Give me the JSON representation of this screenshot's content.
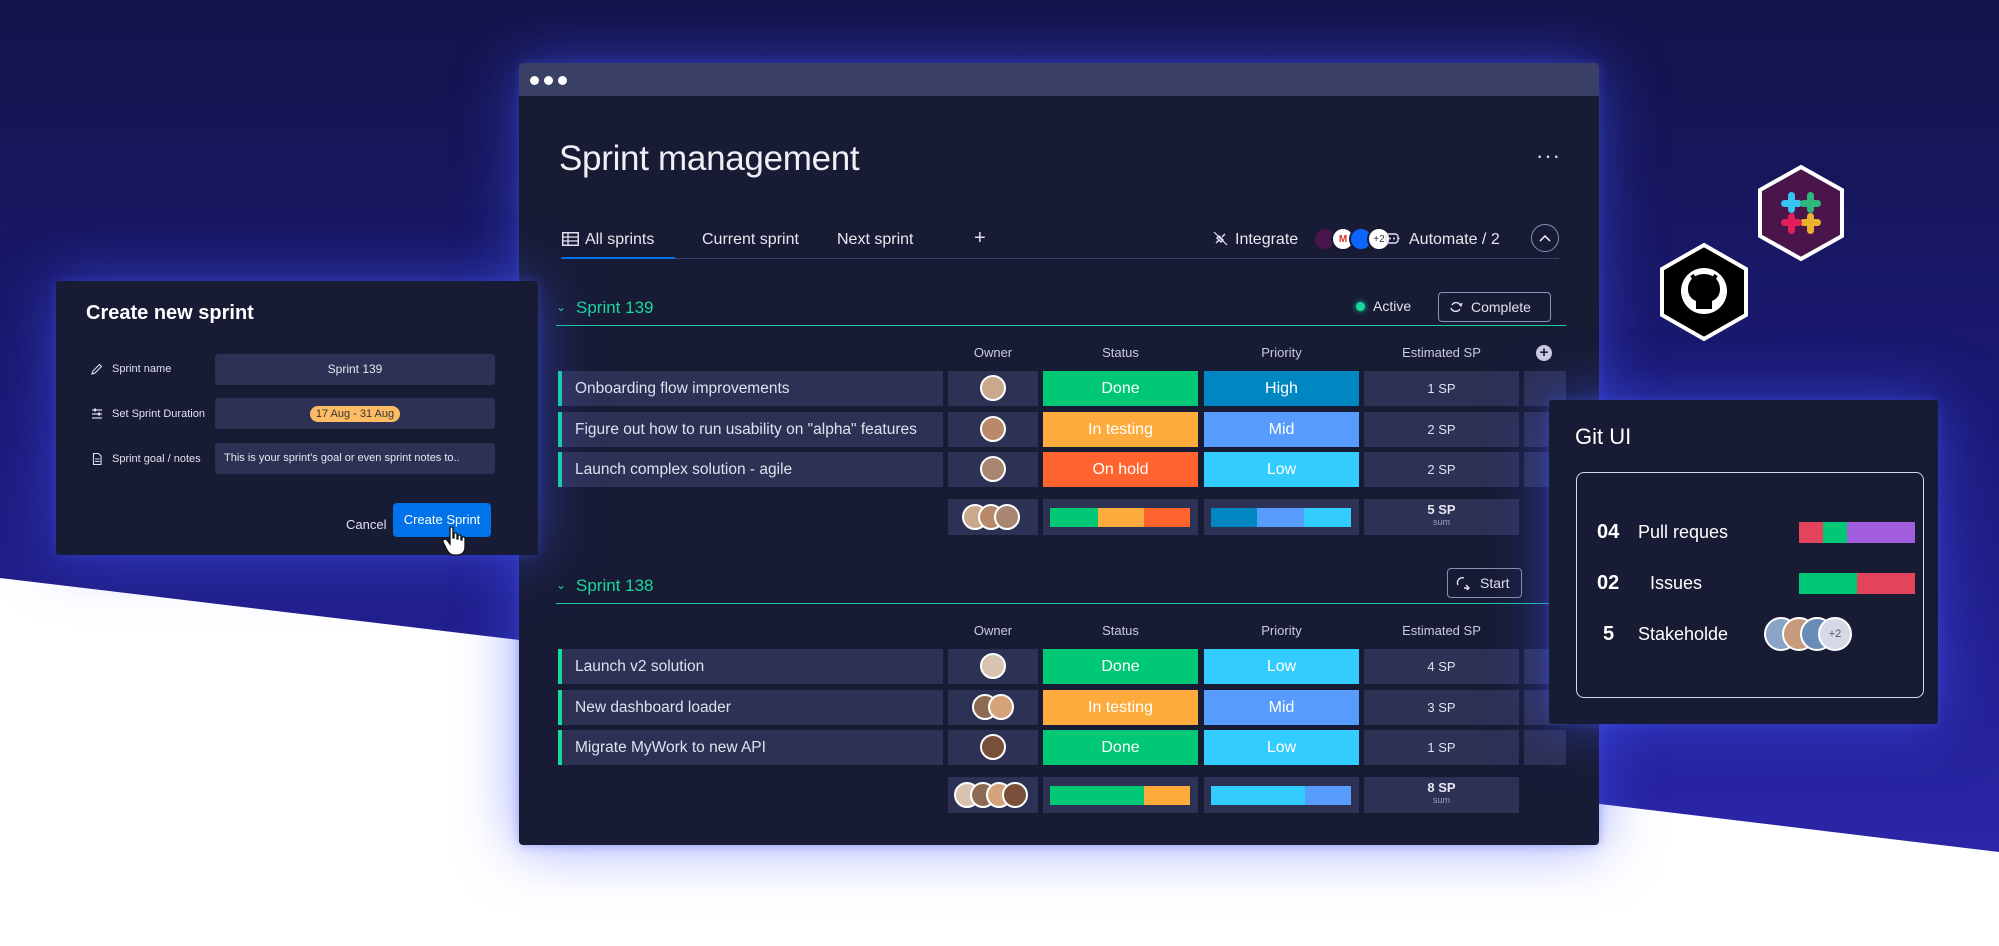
{
  "colors": {
    "done": "#00c875",
    "in_testing": "#fdab3d",
    "on_hold": "#ff642e",
    "high": "#0086c0",
    "mid": "#579bfc",
    "low": "#33ccff",
    "accent": "#0073ea",
    "group": "#19d89b",
    "board_bg": "#181b34",
    "cell_bg": "#2d3154"
  },
  "window": {
    "title": "Sprint management",
    "more_icon": "more-dots-icon",
    "more_label": "···"
  },
  "tabs": [
    {
      "label": "All sprints",
      "icon": "table-icon"
    },
    {
      "label": "Current sprint"
    },
    {
      "label": "Next sprint"
    },
    {
      "label": "+"
    }
  ],
  "toolbar": {
    "integrate_label": "Integrate",
    "integrate_icon": "plug-icon",
    "integrate_more": "+2",
    "automate_label": "Automate / 2",
    "automate_icon": "robot-icon",
    "collapse_icon": "chevron-up-icon"
  },
  "columns": {
    "owner": "Owner",
    "status": "Status",
    "priority": "Priority",
    "estimated": "Estimated SP"
  },
  "groups": [
    {
      "name": "Sprint 139",
      "state_label": "Active",
      "action_label": "Complete",
      "rows": [
        {
          "task": "Onboarding flow improvements",
          "status": "Done",
          "priority": "High",
          "sp": "1 SP"
        },
        {
          "task": "Figure out how to run usability on \"alpha\" features",
          "status": "In testing",
          "priority": "Mid",
          "sp": "2 SP"
        },
        {
          "task": "Launch complex solution - agile",
          "status": "On hold",
          "priority": "Low",
          "sp": "2 SP"
        }
      ],
      "summary": {
        "sp": "5 SP",
        "sp_label": "sum"
      }
    },
    {
      "name": "Sprint 138",
      "action_label": "Start",
      "rows": [
        {
          "task": "Launch v2 solution",
          "status": "Done",
          "priority": "Low",
          "sp": "4 SP"
        },
        {
          "task": "New dashboard loader",
          "status": "In testing",
          "priority": "Mid",
          "sp": "3 SP"
        },
        {
          "task": "Migrate MyWork to new API",
          "status": "Done",
          "priority": "Low",
          "sp": "1 SP"
        }
      ],
      "summary": {
        "sp": "8 SP",
        "sp_label": "sum"
      }
    }
  ],
  "create_sprint": {
    "title": "Create new sprint",
    "fields": [
      {
        "label": "Sprint name",
        "icon": "pencil-icon",
        "value": "Sprint 139"
      },
      {
        "label": "Set Sprint Duration",
        "icon": "sliders-icon",
        "value": "17 Aug - 31 Aug"
      },
      {
        "label": "Sprint goal / notes",
        "icon": "document-icon",
        "value": "This is your sprint's goal or even sprint notes to.."
      }
    ],
    "cancel_label": "Cancel",
    "submit_label": "Create Sprint"
  },
  "git_ui": {
    "title": "Git UI",
    "items": [
      {
        "count": "04",
        "label": "Pull reques"
      },
      {
        "count": "02",
        "label": "Issues"
      },
      {
        "count": "5",
        "label": "Stakeholde",
        "more": "+2"
      }
    ]
  },
  "logos": {
    "slack": "slack-icon",
    "github": "github-icon"
  }
}
